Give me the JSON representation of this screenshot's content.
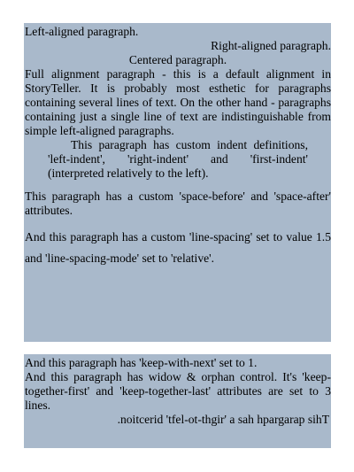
{
  "block1": {
    "paragraphs": [
      {
        "text": "Left-aligned paragraph."
      },
      {
        "text": "Right-aligned paragraph."
      },
      {
        "text": "Centered paragraph."
      },
      {
        "text": "Full alignment paragraph - this is a default alignment in StoryTeller. It is probably most esthetic for paragraphs containing several lines of text. On the other hand - paragraphs containing just a single line of text are indistinguishable from simple left-aligned paragraphs."
      },
      {
        "text": "This paragraph has custom indent definitions, 'left-indent', 'right-indent' and 'first-indent' (interpreted relatively to the left)."
      },
      {
        "text": "This paragraph has a custom 'space-before' and 'space-after' attributes."
      },
      {
        "text": "And this paragraph has a custom 'line-spacing' set to value 1.5 and 'line-spacing-mode' set to 'relative'."
      }
    ]
  },
  "block2": {
    "paragraphs": [
      {
        "text": "And this paragraph has 'keep-with-next' set to 1."
      },
      {
        "text": "And this paragraph has widow & orphan control. It's 'keep-together-first' and 'keep-together-last' attributes are set to 3 lines."
      },
      {
        "text": ".noitcerid 'tfel-ot-thgir' a sah hpargarap sihT"
      }
    ]
  },
  "colors": {
    "block_background": "#a9b9cb",
    "page_background": "#ffffff",
    "text": "#000000"
  }
}
